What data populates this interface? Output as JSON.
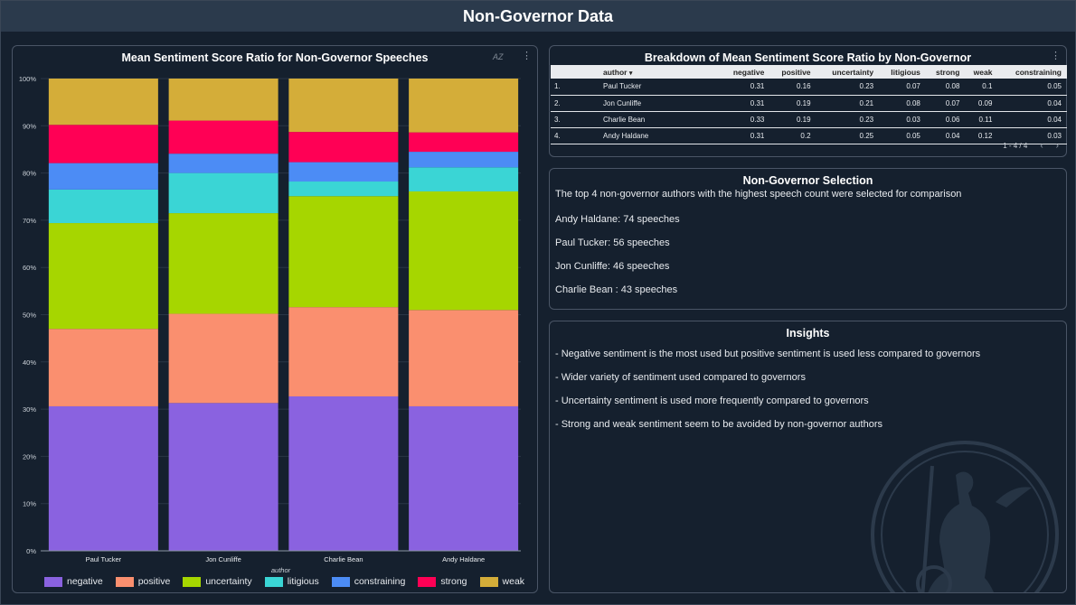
{
  "header": {
    "title": "Non-Governor Data"
  },
  "chart_panel": {
    "title": "Mean Sentiment Score Ratio for Non-Governor Speeches",
    "sort_icon": "AZ",
    "menu_icon": "⋮"
  },
  "chart_data": {
    "type": "bar",
    "stacked": true,
    "percent": true,
    "title": "Mean Sentiment Score Ratio for Non-Governor Speeches",
    "xlabel": "author",
    "ylabel": "",
    "ylim": [
      0,
      100
    ],
    "yticks": [
      "0%",
      "10%",
      "20%",
      "30%",
      "40%",
      "50%",
      "60%",
      "70%",
      "80%",
      "90%",
      "100%"
    ],
    "categories": [
      "Paul Tucker",
      "Jon Cunliffe",
      "Charlie Bean",
      "Andy Haldane"
    ],
    "legend_position": "bottom",
    "series": [
      {
        "name": "negative",
        "color": "#8a62e0",
        "values": [
          30.6,
          31.3,
          32.7,
          30.6
        ]
      },
      {
        "name": "positive",
        "color": "#fa8f6f",
        "values": [
          16.4,
          18.9,
          18.9,
          20.4
        ]
      },
      {
        "name": "uncertainty",
        "color": "#a6d600",
        "values": [
          22.4,
          21.3,
          23.5,
          25.1
        ]
      },
      {
        "name": "litigious",
        "color": "#3ad5d5",
        "values": [
          7.1,
          8.5,
          3.1,
          5.1
        ]
      },
      {
        "name": "constraining",
        "color": "#4c8cf5",
        "values": [
          5.6,
          4.1,
          4.1,
          3.3
        ]
      },
      {
        "name": "strong",
        "color": "#ff0055",
        "values": [
          8.1,
          7.0,
          6.4,
          4.1
        ]
      },
      {
        "name": "weak",
        "color": "#d4ad39",
        "values": [
          9.8,
          8.9,
          11.3,
          11.4
        ]
      }
    ]
  },
  "table_panel": {
    "title": "Breakdown of Mean Sentiment Score Ratio by Non-Governor",
    "menu_icon": "⋮",
    "columns": [
      "author",
      "negative",
      "positive",
      "uncertainty",
      "litigious",
      "strong",
      "weak",
      "constraining"
    ],
    "sort_indicator": "▾",
    "rows": [
      {
        "num": "1.",
        "author": "Paul Tucker",
        "values": [
          "0.31",
          "0.16",
          "0.23",
          "0.07",
          "0.08",
          "0.1",
          "0.05"
        ]
      },
      {
        "num": "2.",
        "author": "Jon Cunliffe",
        "values": [
          "0.31",
          "0.19",
          "0.21",
          "0.08",
          "0.07",
          "0.09",
          "0.04"
        ]
      },
      {
        "num": "3.",
        "author": "Charlie Bean",
        "values": [
          "0.33",
          "0.19",
          "0.23",
          "0.03",
          "0.06",
          "0.11",
          "0.04"
        ]
      },
      {
        "num": "4.",
        "author": "Andy Haldane",
        "values": [
          "0.31",
          "0.2",
          "0.25",
          "0.05",
          "0.04",
          "0.12",
          "0.03"
        ]
      }
    ],
    "pager": {
      "range": "1 - 4 / 4",
      "prev": "‹",
      "next": "›"
    }
  },
  "selection_panel": {
    "title": "Non-Governor Selection",
    "intro": "The top 4 non-governor authors with the highest speech count were selected for comparison",
    "lines": [
      "Andy Haldane: 74 speeches",
      "Paul Tucker: 56 speeches",
      "Jon Cunliffe: 46 speeches",
      "Charlie Bean : 43 speeches"
    ]
  },
  "insights_panel": {
    "title": "Insights",
    "lines": [
      "- Negative sentiment is the most used but positive sentiment is used less compared to governors",
      "- Wider variety of sentiment used compared to governors",
      "- Uncertainty sentiment is used more frequently compared to governors",
      "- Strong and weak sentiment seem to be avoided by non-governor authors"
    ]
  }
}
